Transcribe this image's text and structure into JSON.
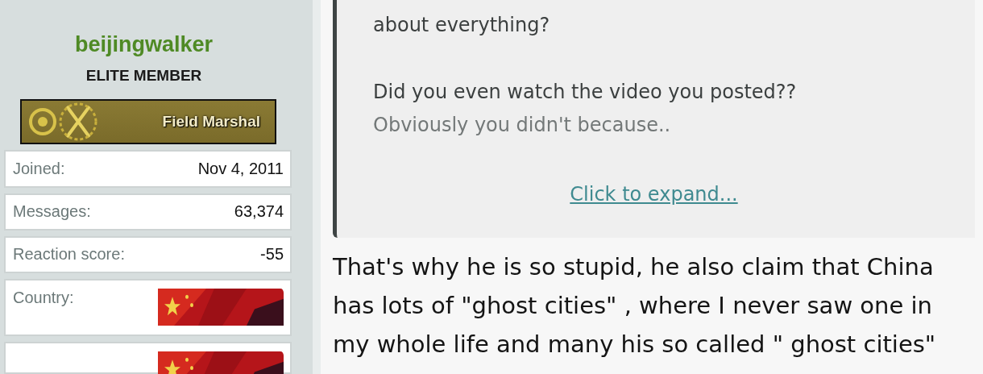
{
  "user": {
    "name": "beijingwalker",
    "title": "ELITE MEMBER",
    "rank_banner": "Field Marshal"
  },
  "stats": [
    {
      "kind": "text",
      "label": "Joined:",
      "value": "Nov 4, 2011"
    },
    {
      "kind": "text",
      "label": "Messages:",
      "value": "63,374"
    },
    {
      "kind": "text",
      "label": "Reaction score:",
      "value": "-55"
    },
    {
      "kind": "flag",
      "label": "Country:"
    },
    {
      "kind": "flag"
    }
  ],
  "quote": {
    "paragraphs": [
      [
        {
          "text": "about everything?",
          "faded": false
        }
      ],
      [
        {
          "text": "Did you even watch the video you posted??",
          "faded": false
        },
        {
          "text": "Obviously you didn't because..",
          "faded": true
        }
      ]
    ],
    "expand_link": "Click to expand..."
  },
  "post": {
    "lines": [
      "That's why he is so stupid, he also claim that China",
      "has lots of \"ghost cities\" , where I never saw one in",
      "my whole life and many his so called \" ghost cities\""
    ]
  }
}
